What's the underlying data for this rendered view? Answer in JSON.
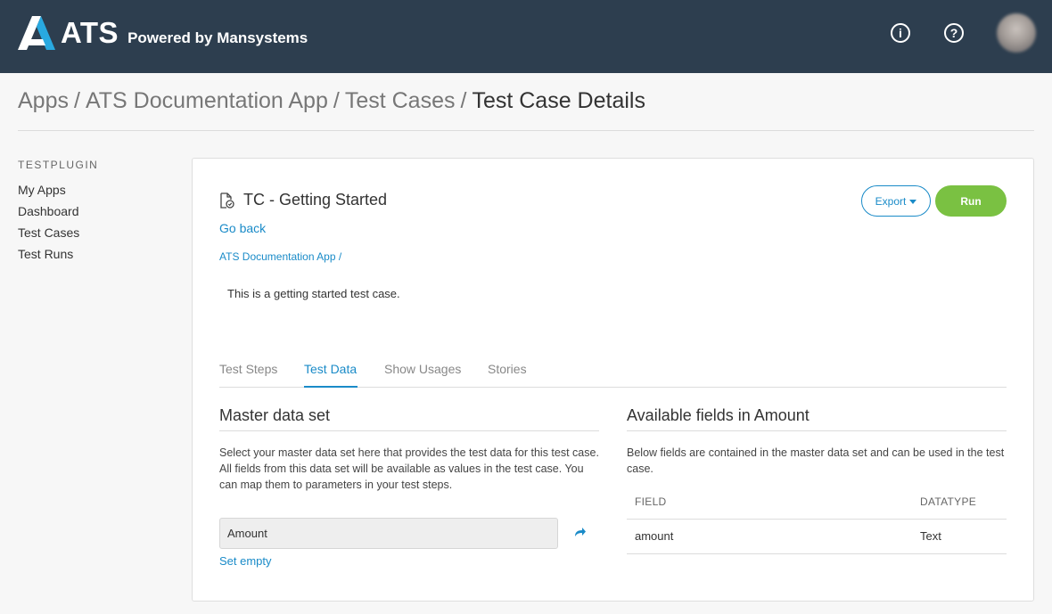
{
  "header": {
    "logo_text": "ATS",
    "powered_by": "Powered by Mansystems",
    "info_icon": "info-icon",
    "help_icon": "help-icon",
    "avatar": "user-avatar"
  },
  "breadcrumb": {
    "items": [
      "Apps",
      "ATS Documentation App",
      "Test Cases"
    ],
    "current": "Test Case Details",
    "separator": "/"
  },
  "sidebar": {
    "title": "TESTPLUGIN",
    "items": [
      {
        "label": "My Apps"
      },
      {
        "label": "Dashboard"
      },
      {
        "label": "Test Cases"
      },
      {
        "label": "Test Runs"
      }
    ]
  },
  "test_case": {
    "title": "TC - Getting Started",
    "go_back": "Go back",
    "app_link": "ATS Documentation App",
    "app_sep": "/",
    "description": "This is a getting started test case.",
    "export_label": "Export",
    "run_label": "Run"
  },
  "tabs": [
    {
      "label": "Test Steps",
      "active": false
    },
    {
      "label": "Test Data",
      "active": true
    },
    {
      "label": "Show Usages",
      "active": false
    },
    {
      "label": "Stories",
      "active": false
    }
  ],
  "master": {
    "title": "Master data set",
    "desc1": "Select your master data set here that provides the test data for this test case.",
    "desc2": "All fields from this data set will be available as values in the test case. You can map them to parameters in your test steps.",
    "selected_value": "Amount",
    "set_empty": "Set empty"
  },
  "fields": {
    "title": "Available fields in Amount",
    "desc": "Below fields are contained in the master data set and can be used in the test case.",
    "columns": [
      "FIELD",
      "DATATYPE"
    ],
    "rows": [
      {
        "field": "amount",
        "datatype": "Text"
      }
    ]
  },
  "colors": {
    "topbar": "#2d3e4f",
    "accent": "#1a8bc8",
    "run": "#7ac142",
    "logo_cyan": "#29a9e0"
  }
}
